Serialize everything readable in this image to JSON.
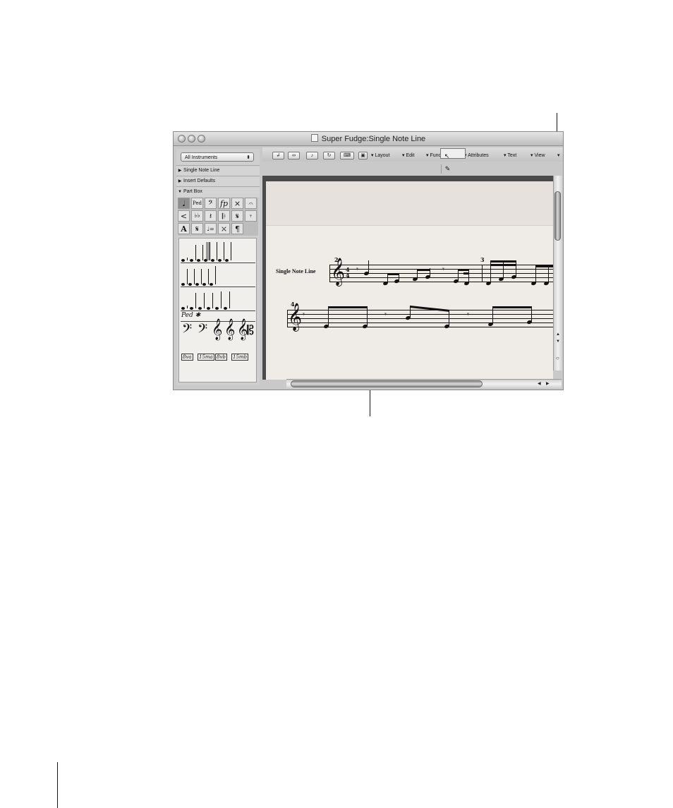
{
  "window": {
    "title": "Super Fudge:Single Note Line"
  },
  "inspector": {
    "popup_value": "All Instruments",
    "sections": [
      {
        "label": "Single Note Line",
        "expanded": false
      },
      {
        "label": "Insert Defaults",
        "expanded": false
      },
      {
        "label": "Part Box",
        "expanded": true
      }
    ],
    "symbol_groups": [
      "𝅘𝅥",
      "Ped",
      "𝄢",
      "fp",
      "×",
      "𝄐",
      "<",
      "♭♭",
      "𝄽",
      "𝄆",
      "𝄋",
      "𝄾",
      "A",
      "𝄋",
      "♩=",
      "⤬",
      "¶"
    ],
    "palette_labels": {
      "ped": "Ped ✱",
      "octave_marks": [
        "8va",
        "15ma",
        "8vb",
        "15mb"
      ]
    }
  },
  "toolbar": {
    "menus": [
      "Layout",
      "Edit",
      "Functions",
      "Attributes",
      "Text",
      "View"
    ],
    "tool_pointer": "↖",
    "tool_pencil": "✎"
  },
  "score": {
    "instrument_name": "Single Note Line",
    "measure_numbers": [
      "2",
      "3",
      "4"
    ],
    "time_signature": {
      "top": "4",
      "bottom": "4"
    }
  },
  "colors": {
    "score_paper": "#efebe6",
    "window_chrome": "#c9c9c9"
  }
}
